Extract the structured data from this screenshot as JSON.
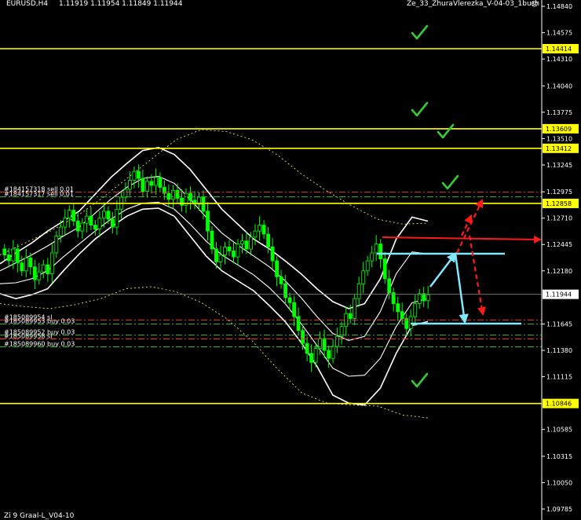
{
  "header": {
    "symbol": "EURUSD,H4",
    "ohlc": "1.11919 1.11954 1.11849 1.11944",
    "expert": "Ze_33_ZhuraVlerezka_V-04-03_1bush",
    "smiley": "☺"
  },
  "footer": {
    "indicator": "Zi 9 Graal-L_V04-10"
  },
  "colors": {
    "background": "#000000",
    "candle": "#00ff00",
    "level": "#ffff00",
    "band": "#ffffff",
    "band_dotted": "#ffff55",
    "order_line_red": "#ff3030",
    "order_line_green": "#33cc33",
    "arrow_red": "#ff1a1a",
    "arrow_cyan": "#80e8ff",
    "check": "#33cc33",
    "bid_line": "#808080",
    "axis_text": "#ffffff"
  },
  "chart_data": {
    "type": "candlestick",
    "title": "EURUSD,H4",
    "ylim": [
      1.0969,
      1.1488
    ],
    "y_ticks": [
      1.1484,
      1.14575,
      1.1431,
      1.1404,
      1.13775,
      1.1351,
      1.13245,
      1.12975,
      1.1271,
      1.12445,
      1.1218,
      1.11645,
      1.1138,
      1.11115,
      1.10585,
      1.10315,
      1.1005,
      1.09785
    ],
    "current_price": {
      "label": "1.11944",
      "value": 1.11944
    },
    "levels": [
      {
        "label": "1.14414",
        "value": 1.14414
      },
      {
        "label": "1.13609",
        "value": 1.13609
      },
      {
        "label": "1.13412",
        "value": 1.13412
      },
      {
        "label": "1.12858",
        "value": 1.12858
      },
      {
        "label": "1.10846",
        "value": 1.10846
      }
    ],
    "order_lines": [
      {
        "text": "#184157318 sell 0.01",
        "value": 1.12972,
        "color": "red"
      },
      {
        "text": "#184157317 sell 0.01",
        "value": 1.12925,
        "color": "green"
      },
      {
        "text": "#185089954 sl",
        "value": 1.11685,
        "color": "red"
      },
      {
        "text": "#185089953 buy 0.03",
        "value": 1.11645,
        "color": "green"
      },
      {
        "text": "#185089952 buy 0.03",
        "value": 1.11535,
        "color": "green"
      },
      {
        "text": "#185089958 sl",
        "value": 1.11495,
        "color": "red"
      },
      {
        "text": "#185089960 buy 0.03",
        "value": 1.11415,
        "color": "green"
      }
    ],
    "candles_close": [
      1.1234,
      1.1228,
      1.124,
      1.1226,
      1.1218,
      1.1231,
      1.1222,
      1.1209,
      1.1217,
      1.1224,
      1.1215,
      1.1236,
      1.1253,
      1.1262,
      1.1271,
      1.1279,
      1.1268,
      1.1258,
      1.1266,
      1.1273,
      1.1264,
      1.126,
      1.1271,
      1.1278,
      1.127,
      1.1262,
      1.128,
      1.1292,
      1.13,
      1.1309,
      1.1318,
      1.1311,
      1.1298,
      1.1308,
      1.1304,
      1.1312,
      1.1302,
      1.1296,
      1.129,
      1.1299,
      1.1291,
      1.1284,
      1.1296,
      1.1289,
      1.1285,
      1.1292,
      1.1278,
      1.1258,
      1.124,
      1.1227,
      1.1234,
      1.1242,
      1.1238,
      1.1232,
      1.1245,
      1.1248,
      1.124,
      1.1252,
      1.1258,
      1.1264,
      1.1255,
      1.1242,
      1.1228,
      1.1212,
      1.1205,
      1.1191,
      1.1186,
      1.1172,
      1.1158,
      1.1145,
      1.1135,
      1.1126,
      1.114,
      1.115,
      1.1138,
      1.113,
      1.1142,
      1.1152,
      1.1162,
      1.1175,
      1.117,
      1.119,
      1.1205,
      1.1218,
      1.1228,
      1.1236,
      1.1245,
      1.123,
      1.121,
      1.1196,
      1.1185,
      1.1177,
      1.117,
      1.116,
      1.1172,
      1.1185,
      1.1195,
      1.1188,
      1.1194
    ],
    "bands": {
      "outer_upper": [
        1.1225,
        1.1236,
        1.1246,
        1.1258,
        1.1268,
        1.1278,
        1.1295,
        1.1312,
        1.1326,
        1.1339,
        1.1342,
        1.1335,
        1.132,
        1.13,
        1.128,
        1.1265,
        1.125,
        1.124,
        1.1228,
        1.1215,
        1.12,
        1.1187,
        1.118,
        1.1185,
        1.121,
        1.125,
        1.1272,
        1.1268
      ],
      "outer_lower": [
        1.1195,
        1.119,
        1.1194,
        1.12,
        1.1218,
        1.1235,
        1.125,
        1.1262,
        1.1273,
        1.128,
        1.1281,
        1.1273,
        1.1253,
        1.1233,
        1.1218,
        1.1208,
        1.1198,
        1.1183,
        1.1167,
        1.1146,
        1.1122,
        1.1093,
        1.1085,
        1.1083,
        1.11,
        1.1135,
        1.1163,
        1.1167
      ],
      "inner_upper": [
        1.1218,
        1.1226,
        1.1234,
        1.1243,
        1.1253,
        1.1262,
        1.1276,
        1.129,
        1.1302,
        1.1311,
        1.1313,
        1.1306,
        1.129,
        1.1272,
        1.1256,
        1.1244,
        1.1233,
        1.1222,
        1.1208,
        1.1191,
        1.1172,
        1.1155,
        1.1148,
        1.1152,
        1.1177,
        1.1215,
        1.1237,
        1.1235
      ],
      "inner_lower": [
        1.1205,
        1.1206,
        1.121,
        1.1218,
        1.1232,
        1.1245,
        1.1258,
        1.127,
        1.128,
        1.1286,
        1.1287,
        1.128,
        1.1265,
        1.1248,
        1.1234,
        1.1224,
        1.1214,
        1.1201,
        1.1185,
        1.1165,
        1.1143,
        1.112,
        1.1112,
        1.1113,
        1.113,
        1.1162,
        1.1186,
        1.119
      ],
      "dotted_upper": [
        1.1234,
        1.1246,
        1.1258,
        1.1272,
        1.129,
        1.131,
        1.133,
        1.135,
        1.136,
        1.1358,
        1.135,
        1.1335,
        1.1315,
        1.1298,
        1.1283,
        1.127,
        1.1265,
        1.1266
      ],
      "dotted_lower": [
        1.1185,
        1.1182,
        1.118,
        1.1184,
        1.119,
        1.12,
        1.1202,
        1.1197,
        1.1186,
        1.117,
        1.1148,
        1.112,
        1.1095,
        1.1085,
        1.1083,
        1.1082,
        1.1073,
        1.107
      ]
    }
  }
}
